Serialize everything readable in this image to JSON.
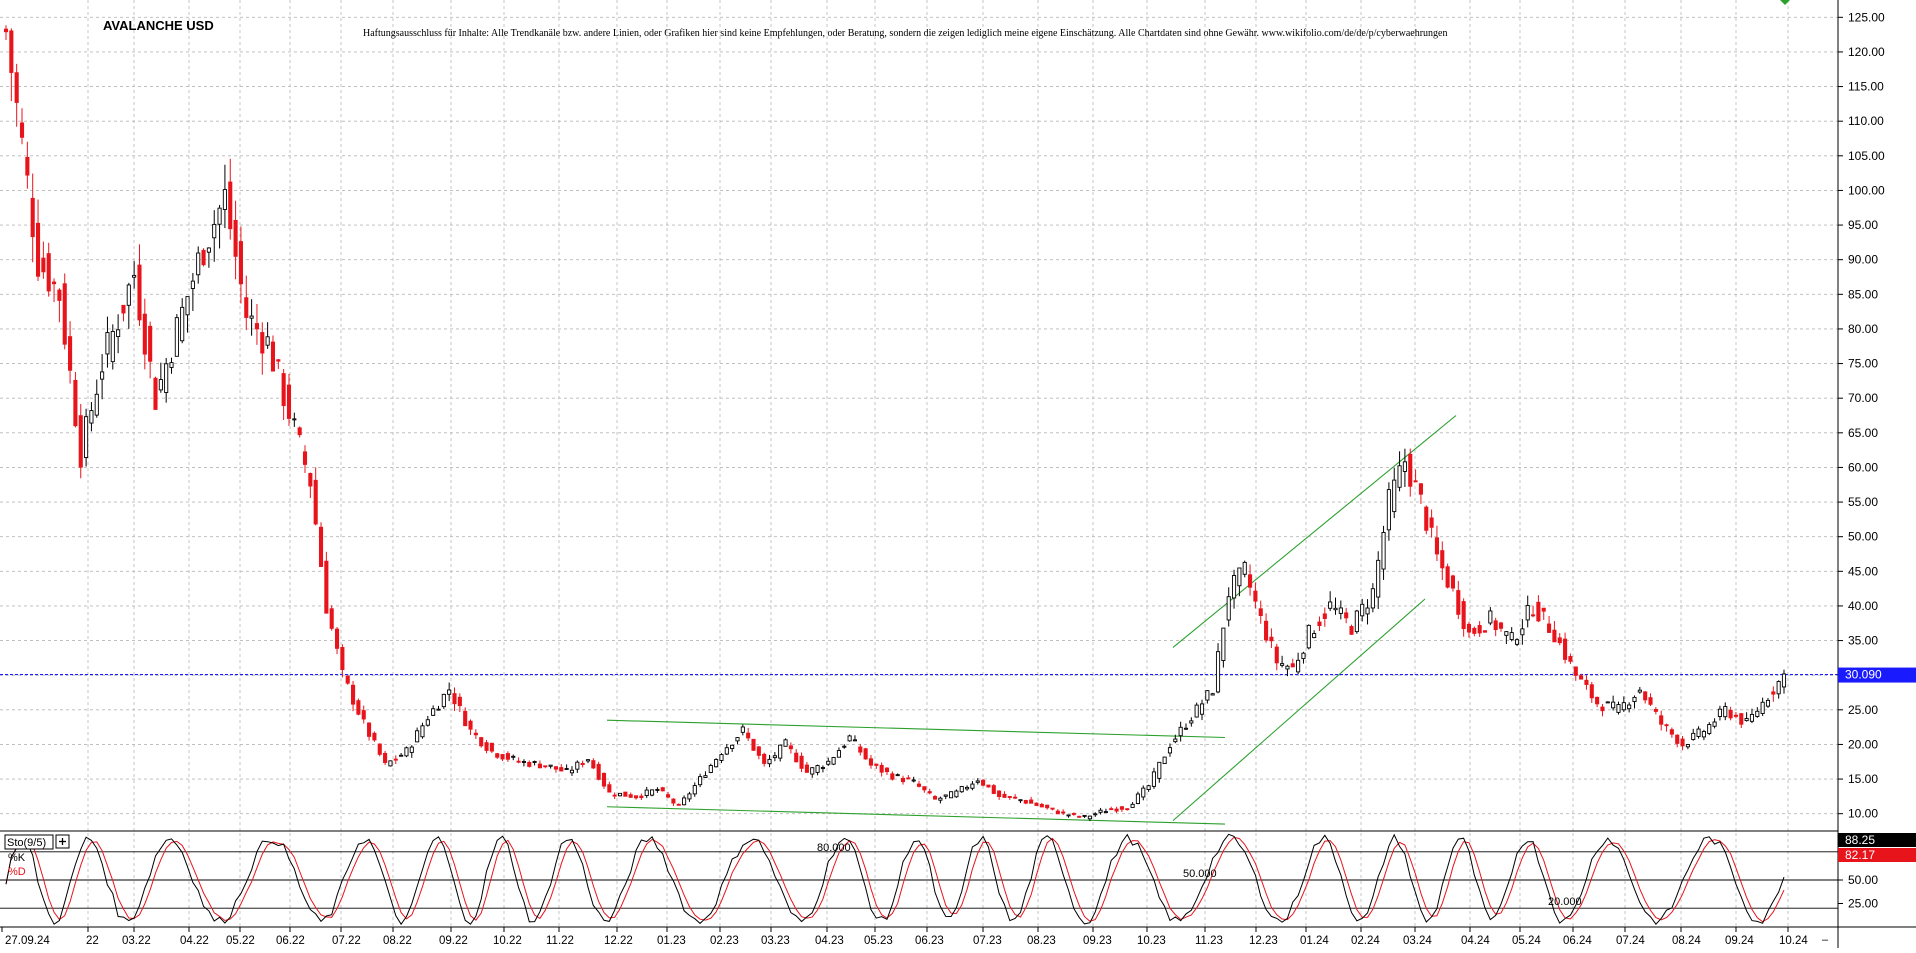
{
  "title": "AVALANCHE USD",
  "disclaimer": "Haftungsausschluss für Inhalte: Alle Trendkanäle bzw. andere Linien, oder Grafiken hier sind keine Empfehlungen, oder Beratung, sondern die zeigen lediglich meine eigene Einschätzung. Alle Chartdaten sind ohne Gewähr.  www.wikifolio.com/de/de/p/cyberwaehrungen",
  "colors": {
    "up_candle": "#000000",
    "down_candle": "#e8141c",
    "trendline": "#2ca02c",
    "price_line": "#1a1aff",
    "grid": "#b8b8b8",
    "last_price_box": "#1a1aff",
    "k_box": "#000000",
    "d_box": "#e8141c"
  },
  "chart_data": [
    {
      "type": "candlestick",
      "name": "price",
      "ylim": [
        7.5,
        127.5
      ],
      "y_ticks": [
        "125.00",
        "120.00",
        "115.00",
        "110.00",
        "105.00",
        "100.00",
        "95.00",
        "90.00",
        "85.00",
        "80.00",
        "75.00",
        "70.00",
        "65.00",
        "60.00",
        "55.00",
        "50.00",
        "45.00",
        "40.00",
        "35.00",
        "30.00",
        "25.00",
        "20.00",
        "15.00",
        "10.00"
      ],
      "x_labels": [
        "27.09.24",
        "22",
        "03.22",
        "04.22",
        "05.22",
        "06.22",
        "07.22",
        "08.22",
        "09.22",
        "10.22",
        "11.22",
        "12.22",
        "01.23",
        "02.23",
        "03.23",
        "04.23",
        "05.23",
        "06.23",
        "07.23",
        "08.23",
        "09.23",
        "10.23",
        "11.23",
        "12.23",
        "01.24",
        "02.24",
        "03.24",
        "04.24",
        "05.24",
        "06.24",
        "07.24",
        "08.24",
        "09.24",
        "10.24"
      ],
      "grid": true,
      "last_price_label": "30.090",
      "last_price": 30.09,
      "anchors": [
        {
          "i": 0,
          "v": 123
        },
        {
          "i": 6,
          "v": 90
        },
        {
          "i": 10,
          "v": 85
        },
        {
          "i": 14,
          "v": 62
        },
        {
          "i": 18,
          "v": 75
        },
        {
          "i": 24,
          "v": 88
        },
        {
          "i": 28,
          "v": 70
        },
        {
          "i": 32,
          "v": 80
        },
        {
          "i": 37,
          "v": 92
        },
        {
          "i": 41,
          "v": 99
        },
        {
          "i": 45,
          "v": 82
        },
        {
          "i": 49,
          "v": 78
        },
        {
          "i": 53,
          "v": 68
        },
        {
          "i": 57,
          "v": 58
        },
        {
          "i": 60,
          "v": 40
        },
        {
          "i": 63,
          "v": 30
        },
        {
          "i": 67,
          "v": 23
        },
        {
          "i": 71,
          "v": 17
        },
        {
          "i": 75,
          "v": 19
        },
        {
          "i": 79,
          "v": 24
        },
        {
          "i": 83,
          "v": 28
        },
        {
          "i": 87,
          "v": 22
        },
        {
          "i": 91,
          "v": 19
        },
        {
          "i": 96,
          "v": 17.5
        },
        {
          "i": 101,
          "v": 17
        },
        {
          "i": 105,
          "v": 16
        },
        {
          "i": 109,
          "v": 18
        },
        {
          "i": 113,
          "v": 13
        },
        {
          "i": 118,
          "v": 12.5
        },
        {
          "i": 122,
          "v": 13.5
        },
        {
          "i": 126,
          "v": 11
        },
        {
          "i": 130,
          "v": 15
        },
        {
          "i": 134,
          "v": 19
        },
        {
          "i": 138,
          "v": 22
        },
        {
          "i": 142,
          "v": 17
        },
        {
          "i": 146,
          "v": 20
        },
        {
          "i": 150,
          "v": 16
        },
        {
          "i": 154,
          "v": 17.5
        },
        {
          "i": 158,
          "v": 21
        },
        {
          "i": 162,
          "v": 17
        },
        {
          "i": 166,
          "v": 15.5
        },
        {
          "i": 170,
          "v": 14.5
        },
        {
          "i": 174,
          "v": 12
        },
        {
          "i": 178,
          "v": 13
        },
        {
          "i": 182,
          "v": 15
        },
        {
          "i": 186,
          "v": 12.5
        },
        {
          "i": 190,
          "v": 12
        },
        {
          "i": 194,
          "v": 11
        },
        {
          "i": 198,
          "v": 10
        },
        {
          "i": 202,
          "v": 9.5
        },
        {
          "i": 206,
          "v": 10.5
        },
        {
          "i": 210,
          "v": 11
        },
        {
          "i": 214,
          "v": 14
        },
        {
          "i": 218,
          "v": 20
        },
        {
          "i": 222,
          "v": 24
        },
        {
          "i": 226,
          "v": 28
        },
        {
          "i": 229,
          "v": 42
        },
        {
          "i": 232,
          "v": 45
        },
        {
          "i": 235,
          "v": 38
        },
        {
          "i": 238,
          "v": 32
        },
        {
          "i": 241,
          "v": 31
        },
        {
          "i": 244,
          "v": 36
        },
        {
          "i": 248,
          "v": 40
        },
        {
          "i": 252,
          "v": 37
        },
        {
          "i": 256,
          "v": 42
        },
        {
          "i": 259,
          "v": 55
        },
        {
          "i": 262,
          "v": 61
        },
        {
          "i": 265,
          "v": 55
        },
        {
          "i": 268,
          "v": 47
        },
        {
          "i": 271,
          "v": 42
        },
        {
          "i": 274,
          "v": 36
        },
        {
          "i": 278,
          "v": 38
        },
        {
          "i": 282,
          "v": 35
        },
        {
          "i": 286,
          "v": 40
        },
        {
          "i": 290,
          "v": 36
        },
        {
          "i": 294,
          "v": 30
        },
        {
          "i": 298,
          "v": 26
        },
        {
          "i": 302,
          "v": 25
        },
        {
          "i": 306,
          "v": 28
        },
        {
          "i": 310,
          "v": 23
        },
        {
          "i": 314,
          "v": 20
        },
        {
          "i": 318,
          "v": 22
        },
        {
          "i": 322,
          "v": 25
        },
        {
          "i": 326,
          "v": 23
        },
        {
          "i": 330,
          "v": 27
        },
        {
          "i": 333,
          "v": 30
        }
      ],
      "trendlines": [
        {
          "label": "triangle-upper",
          "from": [
            "12.22",
            23.5
          ],
          "to": [
            "11.23",
            21
          ]
        },
        {
          "label": "triangle-lower",
          "from": [
            "12.22",
            11
          ],
          "to": [
            "11.23",
            8.5
          ]
        },
        {
          "label": "channel-upper",
          "from": [
            "11.23",
            34
          ],
          "to": [
            "04.24",
            67.5
          ]
        },
        {
          "label": "channel-lower",
          "from": [
            "11.23",
            9
          ],
          "to": [
            "04.24",
            41
          ]
        }
      ]
    },
    {
      "type": "line",
      "name": "stochastic",
      "indicator_label": "Sto(9/5)",
      "ylim": [
        0,
        100
      ],
      "levels": [
        {
          "value": 80,
          "label": "80.000"
        },
        {
          "value": 50,
          "label": "50.000"
        },
        {
          "value": 20,
          "label": "20.000"
        }
      ],
      "y_ticks": [
        "50.00",
        "25.00"
      ],
      "series": [
        {
          "name": "%K",
          "last_label": "88.25",
          "color": "#000000"
        },
        {
          "name": "%D",
          "last_label": "82.17",
          "color": "#e8141c"
        }
      ]
    }
  ]
}
